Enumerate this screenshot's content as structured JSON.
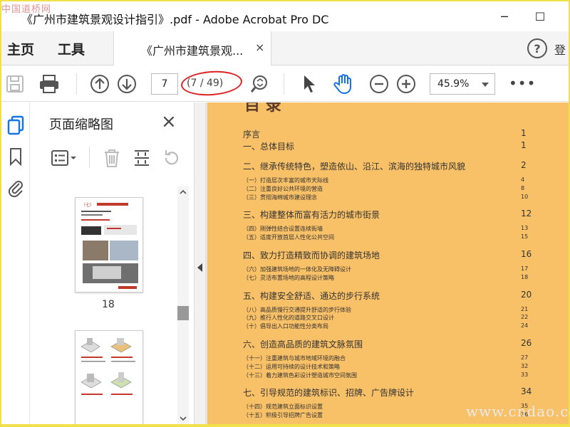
{
  "window": {
    "title": "《广州市建筑景观设计指引》.pdf - Adobe Acrobat Pro DC",
    "watermark_top": "中国道桥网",
    "minimize": "─",
    "maximize": "☐"
  },
  "tabs": {
    "home": "主页",
    "tools": "工具",
    "doc": "《广州市建筑景观...",
    "doc_close": "×",
    "help": "?",
    "signin": "登"
  },
  "toolbar": {
    "page_current": "7",
    "page_count": "(7 / 49)",
    "zoom": "45.9%",
    "more": "•••"
  },
  "thumbs": {
    "title": "页面缩略图",
    "close": "×",
    "page_label": "18"
  },
  "toc": {
    "heading": "目 录",
    "entries": [
      {
        "text": "序言",
        "page": "1",
        "level": "main"
      },
      {
        "text": "一、总体目标",
        "page": "1",
        "level": "main"
      },
      {
        "text": "二、继承传统特色，塑造依山、沿江、滨海的独特城市风貌",
        "page": "2",
        "level": "main"
      },
      {
        "text": "（一）打造层次丰富的城市天际线",
        "page": "4",
        "level": "sub"
      },
      {
        "text": "（二）注重良好公共环境的营造",
        "page": "8",
        "level": "sub"
      },
      {
        "text": "（三）贯彻海绵城市建设理念",
        "page": "10",
        "level": "sub"
      },
      {
        "text": "三、构建整体而富有活力的城市街景",
        "page": "12",
        "level": "main"
      },
      {
        "text": "（四）刚弹性结合设置连续街墙",
        "page": "13",
        "level": "sub"
      },
      {
        "text": "（五）适度开放首层人性化公共空间",
        "page": "15",
        "level": "sub"
      },
      {
        "text": "四、致力打造精致而协调的建筑场地",
        "page": "16",
        "level": "main"
      },
      {
        "text": "（六）加强建筑场地的一体化及无障碍设计",
        "page": "17",
        "level": "sub"
      },
      {
        "text": "（七）灵活布置场地的高程设计策略",
        "page": "18",
        "level": "sub"
      },
      {
        "text": "五、构建安全舒适、通达的步行系统",
        "page": "20",
        "level": "main"
      },
      {
        "text": "（八）高品质慢行交通提升舒适的步行体验",
        "page": "21",
        "level": "sub"
      },
      {
        "text": "（九）推行人性化的道路交叉口设计",
        "page": "22",
        "level": "sub"
      },
      {
        "text": "（十）倡导出入口功能性分类布局",
        "page": "24",
        "level": "sub"
      },
      {
        "text": "六、创造高品质的建筑文脉氛围",
        "page": "26",
        "level": "main"
      },
      {
        "text": "（十一）注重建筑与城市地域环境的融合",
        "page": "27",
        "level": "sub"
      },
      {
        "text": "（十二）运用可持续的设计技术和策略",
        "page": "32",
        "level": "sub"
      },
      {
        "text": "（十三）着力建筑色彩设计塑造城市空间氛围",
        "page": "33",
        "level": "sub"
      },
      {
        "text": "七、引导规范的建筑标识、招牌、广告牌设计",
        "page": "34",
        "level": "main"
      },
      {
        "text": "（十四）规范建筑立面标识设置",
        "page": "35",
        "level": "sub"
      },
      {
        "text": "（十五）积极引导招牌广告设置",
        "page": "36",
        "level": "sub"
      }
    ]
  },
  "watermark_br": "www.cndao.com",
  "colors": {
    "page_bg": "#f8c067",
    "accent_blue": "#1473e6",
    "annotation_red": "#d22222"
  }
}
